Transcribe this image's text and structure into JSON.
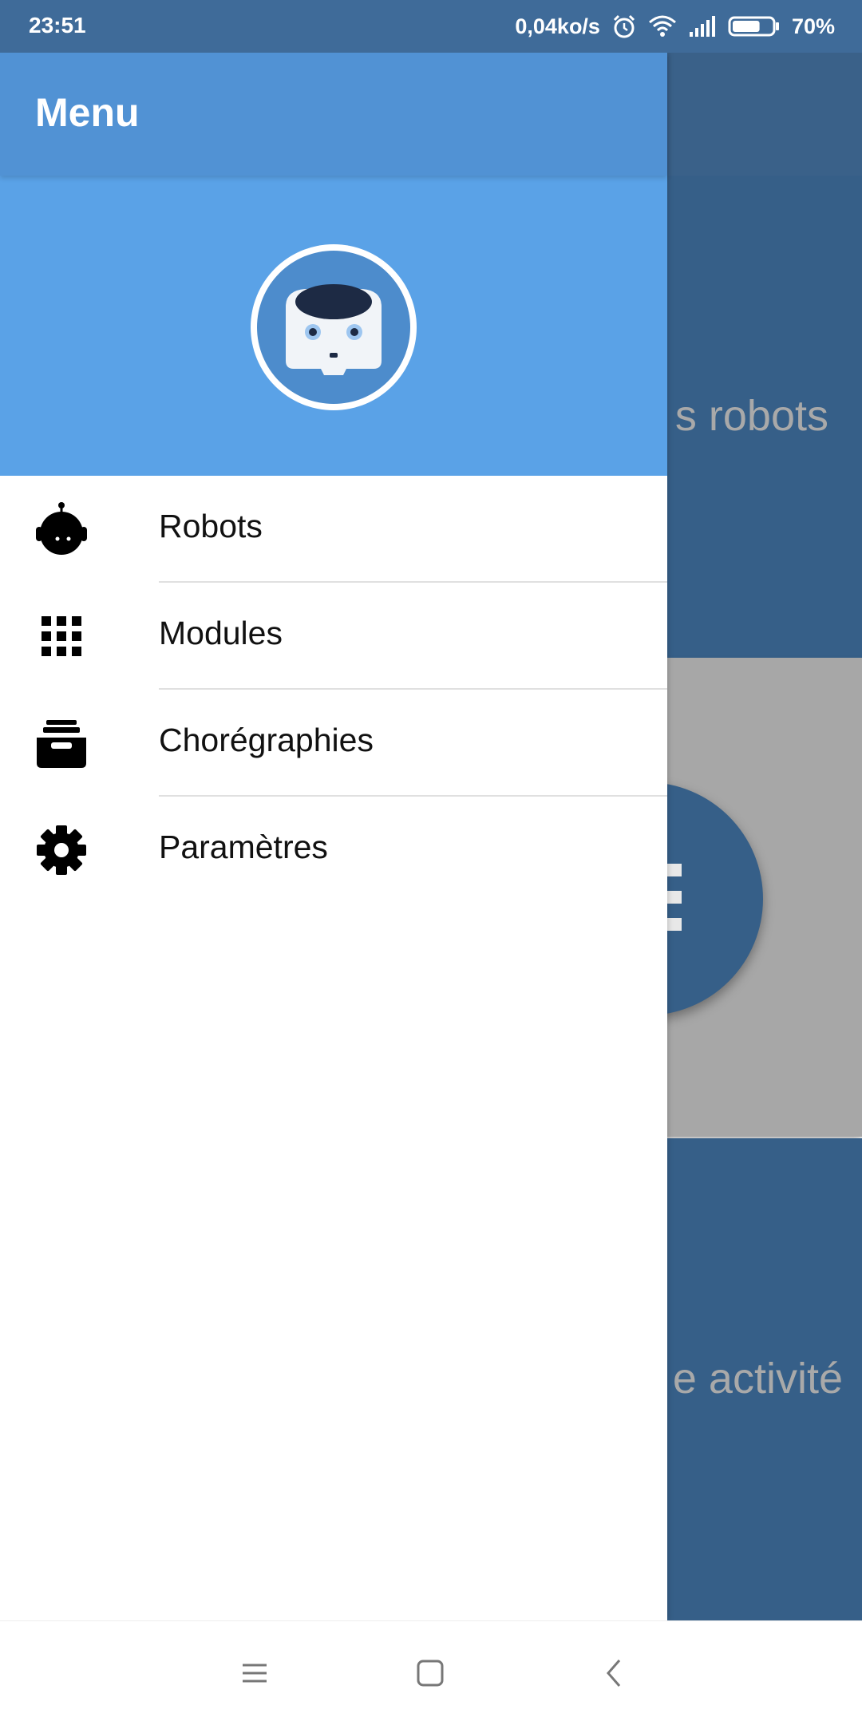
{
  "status_bar": {
    "time": "23:51",
    "network_speed": "0,04ko/s",
    "battery_percent": "70%",
    "battery_level": 0.7,
    "icons": [
      "alarm-icon",
      "wifi-icon",
      "signal-icon",
      "battery-icon"
    ]
  },
  "background": {
    "card_top_text": "s robots",
    "card_bottom_text": "e activité"
  },
  "drawer": {
    "title": "Menu",
    "avatar": "robot-avatar-icon",
    "items": [
      {
        "label": "Robots",
        "icon": "robot-icon"
      },
      {
        "label": "Modules",
        "icon": "grid-icon"
      },
      {
        "label": "Chorégraphies",
        "icon": "inbox-icon"
      },
      {
        "label": "Paramètres",
        "icon": "gear-icon"
      }
    ]
  },
  "nav_bar": {
    "buttons": [
      "menu-icon",
      "home-icon",
      "back-icon"
    ]
  },
  "colors": {
    "drawer_toolbar": "#5192d4",
    "drawer_header": "#5aa2e7",
    "status_bar": "#3f6b99",
    "background_card": "#365f88"
  }
}
